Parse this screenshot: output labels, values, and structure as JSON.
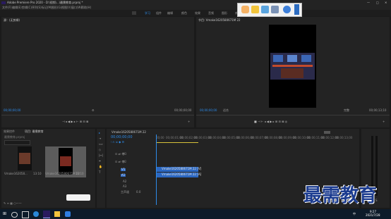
{
  "app": {
    "title": "Adobe Premiere Pro 2020 - D:\\视频\\...\\最需教育.prproj *",
    "window_controls": [
      "—",
      "□",
      "✕"
    ]
  },
  "menu": [
    "文件(F)",
    "编辑(E)",
    "剪辑(C)",
    "序列(S)",
    "标记(M)",
    "图形(G)",
    "视图(V)",
    "窗口(W)",
    "帮助(H)"
  ],
  "workspaces": [
    "学习",
    "组件",
    "编辑",
    "颜色",
    "效果",
    "音频",
    "图形",
    "库"
  ],
  "source_panel": {
    "title": "源：(无剪辑)",
    "left_tc": "00;00;00;00",
    "right_tc": "00;00;00;00"
  },
  "program_panel": {
    "title": "节目: Vmake1620580671M 22",
    "left_tc": "00;00;00;00",
    "fit": "适合",
    "full": "完整",
    "right_tc": "00;00;13;10"
  },
  "project_panel": {
    "tabs": [
      "效果控件",
      "项目: 最需教育"
    ],
    "project_name": "最需教育.prproj",
    "items": [
      {
        "name": "Vmake162058...",
        "duration": "13:10"
      },
      {
        "name": "Vmake1620580671M 22",
        "duration": "13:10"
      }
    ]
  },
  "timeline": {
    "tab": "Vmake1620580671M 22",
    "timecode": "00;00;00;00",
    "tracks": [
      "V3",
      "V2",
      "V1",
      "A1",
      "A2",
      "A3",
      "主声道"
    ],
    "master_value": "0.0",
    "video_clip": "Vmake1620580671M 22 [V]",
    "audio_clip": "Vmake1620580671M 22 [A]",
    "ruler": [
      "00;00",
      "00;00;01;00",
      "00;00;02;00",
      "00;00;03;00",
      "00;00;04;00",
      "00;00;05;00",
      "00;00;06;00",
      "00;00;07;00",
      "00;00;08;00",
      "00;00;09;00",
      "00;00;10;00",
      "00;00;11;00",
      "00;00;12;00",
      "00;00;13;00"
    ]
  },
  "audio_meter": {
    "labels": [
      "S",
      "S"
    ]
  },
  "taskbar": {
    "time": "9:27",
    "date": "2021/7/28",
    "lang": "中"
  },
  "watermark": "最需教育",
  "colors": {
    "accent": "#2d8ceb",
    "clip": "#2b67c1",
    "background": "#1a1a1a",
    "panel": "#232323"
  }
}
